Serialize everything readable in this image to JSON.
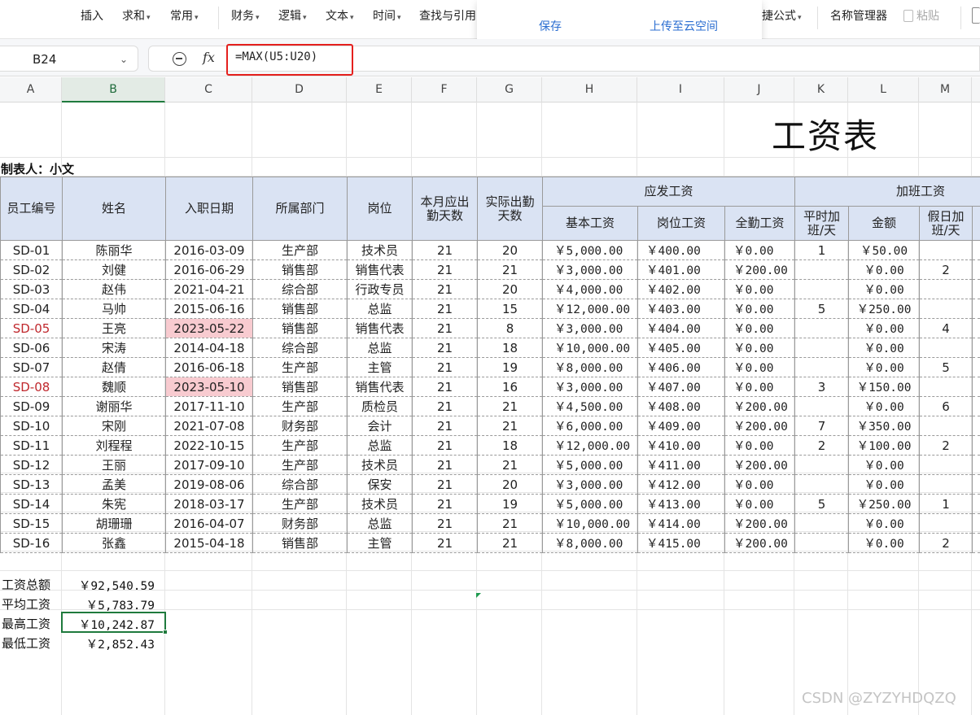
{
  "ribbon": {
    "items": [
      {
        "label": "插入",
        "arrow": ""
      },
      {
        "label": "求和",
        "arrow": "▾"
      },
      {
        "label": "常用",
        "arrow": "▾"
      },
      {
        "label": "财务",
        "arrow": "▾"
      },
      {
        "label": "逻辑",
        "arrow": "▾"
      },
      {
        "label": "文本",
        "arrow": "▾"
      },
      {
        "label": "时间",
        "arrow": "▾"
      },
      {
        "label": "查找与引用",
        "arrow": ""
      },
      {
        "label": "捷公式",
        "arrow": "▾"
      },
      {
        "label": "名称管理器",
        "arrow": ""
      },
      {
        "label": "粘贴",
        "arrow": ""
      }
    ]
  },
  "popup": {
    "save": "保存",
    "upload": "上传至云空间"
  },
  "formula_bar": {
    "cell_ref": "B24",
    "fx": "fx",
    "formula": "=MAX(U5:U20)"
  },
  "columns": [
    "A",
    "B",
    "C",
    "D",
    "E",
    "F",
    "G",
    "H",
    "I",
    "J",
    "K",
    "L",
    "M"
  ],
  "sheet": {
    "title": "工资表",
    "preparer": "制表人：小文",
    "headers": {
      "emp_id": "员工编号",
      "name": "姓名",
      "hire_date": "入职日期",
      "dept": "所属部门",
      "position": "岗位",
      "required_days": "本月应出勤天数",
      "actual_days": "实际出勤天数",
      "gross_pay": "应发工资",
      "base_pay": "基本工资",
      "post_pay": "岗位工资",
      "attendance_pay": "全勤工资",
      "overtime": "加班工资",
      "ot_weekday": "平时加班/天",
      "ot_amount": "金额",
      "ot_holiday": "假日加班/天"
    },
    "rows": [
      {
        "id": "SD-01",
        "name": "陈丽华",
        "date": "2016-03-09",
        "dept": "生产部",
        "pos": "技术员",
        "req": "21",
        "act": "20",
        "base": "￥5,000.00",
        "post": "￥400.00",
        "full": "￥0.00",
        "otw": "1",
        "ota": "￥50.00",
        "oth": "",
        "warn": false
      },
      {
        "id": "SD-02",
        "name": "刘健",
        "date": "2016-06-29",
        "dept": "销售部",
        "pos": "销售代表",
        "req": "21",
        "act": "21",
        "base": "￥3,000.00",
        "post": "￥401.00",
        "full": "￥200.00",
        "otw": "",
        "ota": "￥0.00",
        "oth": "2",
        "warn": false
      },
      {
        "id": "SD-03",
        "name": "赵伟",
        "date": "2021-04-21",
        "dept": "综合部",
        "pos": "行政专员",
        "req": "21",
        "act": "20",
        "base": "￥4,000.00",
        "post": "￥402.00",
        "full": "￥0.00",
        "otw": "",
        "ota": "￥0.00",
        "oth": "",
        "warn": false
      },
      {
        "id": "SD-04",
        "name": "马帅",
        "date": "2015-06-16",
        "dept": "销售部",
        "pos": "总监",
        "req": "21",
        "act": "15",
        "base": "￥12,000.00",
        "post": "￥403.00",
        "full": "￥0.00",
        "otw": "5",
        "ota": "￥250.00",
        "oth": "",
        "warn": false
      },
      {
        "id": "SD-05",
        "name": "王亮",
        "date": "2023-05-22",
        "dept": "销售部",
        "pos": "销售代表",
        "req": "21",
        "act": "8",
        "base": "￥3,000.00",
        "post": "￥404.00",
        "full": "￥0.00",
        "otw": "",
        "ota": "￥0.00",
        "oth": "4",
        "warn": true
      },
      {
        "id": "SD-06",
        "name": "宋涛",
        "date": "2014-04-18",
        "dept": "综合部",
        "pos": "总监",
        "req": "21",
        "act": "18",
        "base": "￥10,000.00",
        "post": "￥405.00",
        "full": "￥0.00",
        "otw": "",
        "ota": "￥0.00",
        "oth": "",
        "warn": false
      },
      {
        "id": "SD-07",
        "name": "赵倩",
        "date": "2016-06-18",
        "dept": "生产部",
        "pos": "主管",
        "req": "21",
        "act": "19",
        "base": "￥8,000.00",
        "post": "￥406.00",
        "full": "￥0.00",
        "otw": "",
        "ota": "￥0.00",
        "oth": "5",
        "warn": false
      },
      {
        "id": "SD-08",
        "name": "魏顺",
        "date": "2023-05-10",
        "dept": "销售部",
        "pos": "销售代表",
        "req": "21",
        "act": "16",
        "base": "￥3,000.00",
        "post": "￥407.00",
        "full": "￥0.00",
        "otw": "3",
        "ota": "￥150.00",
        "oth": "",
        "warn": true
      },
      {
        "id": "SD-09",
        "name": "谢丽华",
        "date": "2017-11-10",
        "dept": "生产部",
        "pos": "质检员",
        "req": "21",
        "act": "21",
        "base": "￥4,500.00",
        "post": "￥408.00",
        "full": "￥200.00",
        "otw": "",
        "ota": "￥0.00",
        "oth": "6",
        "warn": false
      },
      {
        "id": "SD-10",
        "name": "宋刚",
        "date": "2021-07-08",
        "dept": "财务部",
        "pos": "会计",
        "req": "21",
        "act": "21",
        "base": "￥6,000.00",
        "post": "￥409.00",
        "full": "￥200.00",
        "otw": "7",
        "ota": "￥350.00",
        "oth": "",
        "warn": false
      },
      {
        "id": "SD-11",
        "name": "刘程程",
        "date": "2022-10-15",
        "dept": "生产部",
        "pos": "总监",
        "req": "21",
        "act": "18",
        "base": "￥12,000.00",
        "post": "￥410.00",
        "full": "￥0.00",
        "otw": "2",
        "ota": "￥100.00",
        "oth": "2",
        "warn": false
      },
      {
        "id": "SD-12",
        "name": "王丽",
        "date": "2017-09-10",
        "dept": "生产部",
        "pos": "技术员",
        "req": "21",
        "act": "21",
        "base": "￥5,000.00",
        "post": "￥411.00",
        "full": "￥200.00",
        "otw": "",
        "ota": "￥0.00",
        "oth": "",
        "warn": false
      },
      {
        "id": "SD-13",
        "name": "孟美",
        "date": "2019-08-06",
        "dept": "综合部",
        "pos": "保安",
        "req": "21",
        "act": "20",
        "base": "￥3,000.00",
        "post": "￥412.00",
        "full": "￥0.00",
        "otw": "",
        "ota": "￥0.00",
        "oth": "",
        "warn": false
      },
      {
        "id": "SD-14",
        "name": "朱宪",
        "date": "2018-03-17",
        "dept": "生产部",
        "pos": "技术员",
        "req": "21",
        "act": "19",
        "base": "￥5,000.00",
        "post": "￥413.00",
        "full": "￥0.00",
        "otw": "5",
        "ota": "￥250.00",
        "oth": "1",
        "warn": false
      },
      {
        "id": "SD-15",
        "name": "胡珊珊",
        "date": "2016-04-07",
        "dept": "财务部",
        "pos": "总监",
        "req": "21",
        "act": "21",
        "base": "￥10,000.00",
        "post": "￥414.00",
        "full": "￥200.00",
        "otw": "",
        "ota": "￥0.00",
        "oth": "",
        "warn": false
      },
      {
        "id": "SD-16",
        "name": "张鑫",
        "date": "2015-04-18",
        "dept": "销售部",
        "pos": "主管",
        "req": "21",
        "act": "21",
        "base": "￥8,000.00",
        "post": "￥415.00",
        "full": "￥200.00",
        "otw": "",
        "ota": "￥0.00",
        "oth": "2",
        "warn": false
      }
    ],
    "summary": [
      {
        "label": "工资总额",
        "value": "￥92,540.59"
      },
      {
        "label": "平均工资",
        "value": "￥5,783.79"
      },
      {
        "label": "最高工资",
        "value": "￥10,242.87"
      },
      {
        "label": "最低工资",
        "value": "￥2,852.43"
      }
    ]
  },
  "colors": {
    "accent_green": "#1f7a3d",
    "highlight_pink": "#f8cbd0",
    "header_blue": "#dae3f3",
    "warn_red": "#c0282d",
    "formula_border_red": "#e5201e"
  },
  "watermark": "CSDN @ZYZYHDQZQ"
}
